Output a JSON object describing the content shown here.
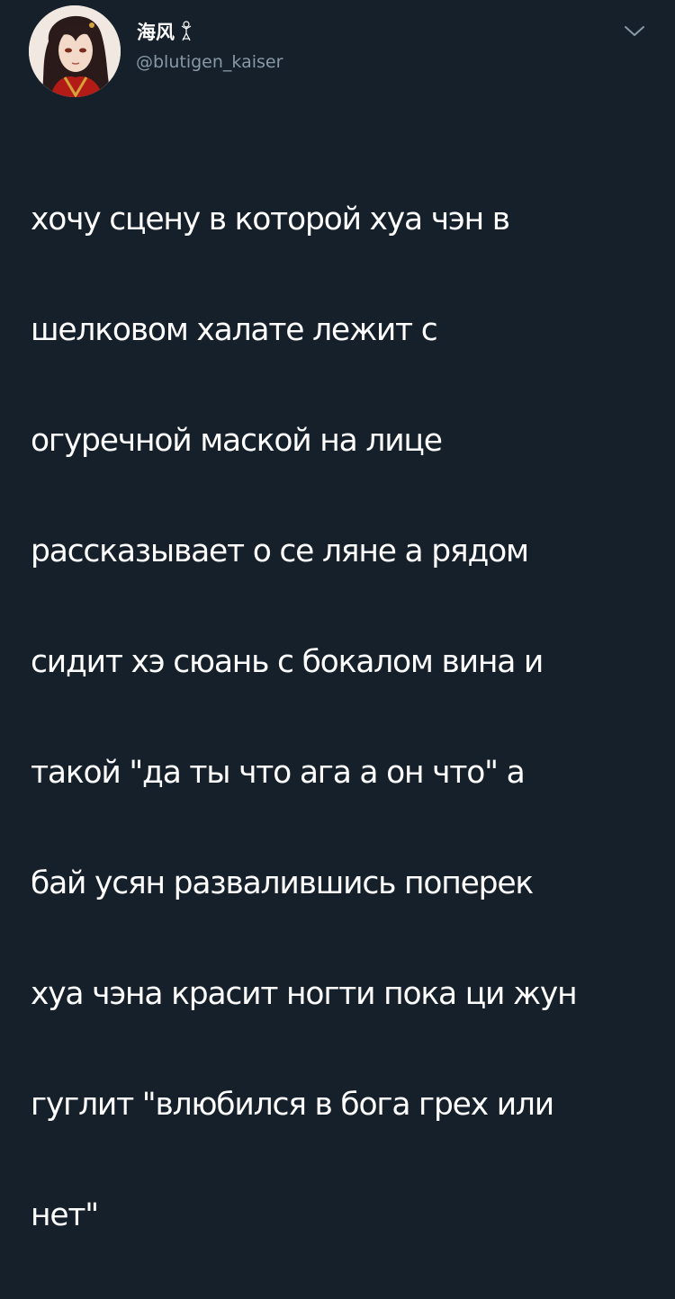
{
  "tweet": {
    "author": {
      "display_name": "海风",
      "name_emoji_icon": "woman-dancing-emoji-icon",
      "handle": "@blutigen_kaiser",
      "avatar_icon": "anime-portrait-avatar"
    },
    "menu_icon": "chevron-down-icon",
    "text_lines": [
      "хочу сцену в которой хуа чэн в",
      "шелковом халате лежит с",
      "огуречной маской на лице",
      "рассказывает о се ляне а рядом",
      "сидит хэ сюань с бокалом вина и",
      "такой \"да ты что ага а он что\" а",
      "бай усян развалившись поперек",
      "хуа чэна красит ногти пока ци жун",
      "гуглит \"влюбился в бога грех или",
      "нет\""
    ]
  },
  "theme": {
    "background": "#15202b",
    "text_primary": "#ffffff",
    "text_secondary": "#8899a6"
  }
}
